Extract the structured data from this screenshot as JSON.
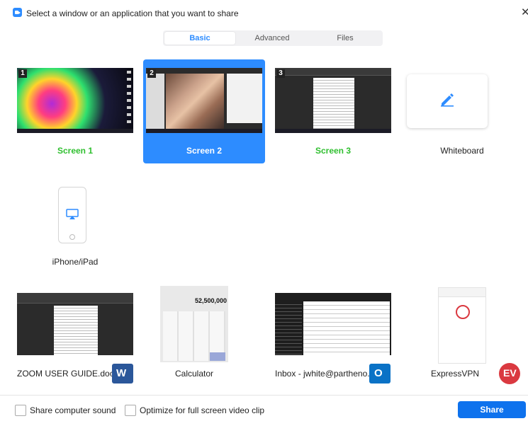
{
  "window": {
    "title": "Select a window or an application that you want to share",
    "close_glyph": "✕"
  },
  "tabs": [
    {
      "label": "Basic",
      "active": true
    },
    {
      "label": "Advanced",
      "active": false
    },
    {
      "label": "Files",
      "active": false
    }
  ],
  "screens": [
    {
      "label": "Screen 1",
      "badge": "1",
      "selected": false
    },
    {
      "label": "Screen 2",
      "badge": "2",
      "selected": true
    },
    {
      "label": "Screen 3",
      "badge": "3",
      "selected": false
    }
  ],
  "whiteboard": {
    "label": "Whiteboard",
    "icon": "pencil-icon"
  },
  "iphone": {
    "label": "iPhone/iPad",
    "icon": "airplay-icon"
  },
  "windows": [
    {
      "label": "ZOOM USER GUIDE.docx...",
      "app_icon": "word-logo-icon",
      "icon_letter": "W"
    },
    {
      "label": "Calculator",
      "display": "52,500,000"
    },
    {
      "label": "Inbox - jwhite@partheno...",
      "app_icon": "outlook-logo-icon",
      "icon_letter": "O"
    },
    {
      "label": "ExpressVPN",
      "app_icon": "expressvpn-logo-icon",
      "icon_letter": "EV"
    }
  ],
  "footer": {
    "share_sound_label": "Share computer sound",
    "optimize_label": "Optimize for full screen video clip",
    "share_button": "Share"
  },
  "colors": {
    "accent": "#2d8cff",
    "share_button": "#0e72ed",
    "screen_label": "#2fbf2f"
  }
}
